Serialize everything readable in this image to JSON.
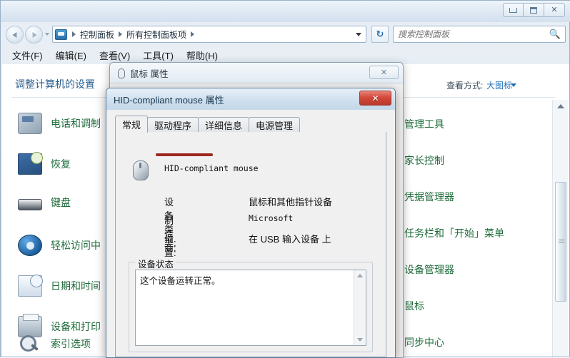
{
  "window": {
    "controls": {
      "minimize": "minimize-icon",
      "maximize": "maximize-icon",
      "close": "✕"
    }
  },
  "address": {
    "breadcrumbs": [
      "控制面板",
      "所有控制面板项"
    ],
    "refresh_label": "↻",
    "cp_icon": "control-panel-icon"
  },
  "search": {
    "placeholder": "搜索控制面板",
    "value": "",
    "icon": "🔍"
  },
  "menu": {
    "items": [
      "文件(F)",
      "编辑(E)",
      "查看(V)",
      "工具(T)",
      "帮助(H)"
    ]
  },
  "content": {
    "page_title": "调整计算机的设置",
    "viewby_label": "查看方式:",
    "viewby_value": "大图标",
    "left_items": [
      {
        "label": "电话和调制",
        "icon": "modem-icon"
      },
      {
        "label": "恢复",
        "icon": "recovery-icon"
      },
      {
        "label": "键盘",
        "icon": "keyboard-icon"
      },
      {
        "label": "轻松访问中",
        "icon": "ease-of-access-icon"
      },
      {
        "label": "日期和时间",
        "icon": "date-time-icon"
      },
      {
        "label": "设备和打印",
        "icon": "printer-icon"
      },
      {
        "label": "索引选项",
        "icon": "search-options-icon"
      }
    ],
    "right_items": [
      {
        "label": "管理工具"
      },
      {
        "label": "家长控制"
      },
      {
        "label": "凭据管理器"
      },
      {
        "label": "任务栏和「开始」菜单"
      },
      {
        "label": "设备管理器"
      },
      {
        "label": "鼠标"
      },
      {
        "label": "同步中心"
      }
    ]
  },
  "mouse_props_dialog": {
    "title": "鼠标 属性",
    "close_label": "✕",
    "icon": "mouse-icon"
  },
  "hid_dialog": {
    "title": "HID-compliant mouse 属性",
    "close_label": "✕",
    "tabs": [
      {
        "label": "常规",
        "active": true
      },
      {
        "label": "驱动程序",
        "active": false
      },
      {
        "label": "详细信息",
        "active": false
      },
      {
        "label": "电源管理",
        "active": false
      }
    ],
    "device_name": "HID-compliant mouse",
    "fields": [
      {
        "label": "设备类型:",
        "value": "鼠标和其他指针设备",
        "mono": false
      },
      {
        "label": "制造商:",
        "value": "Microsoft",
        "mono": true
      },
      {
        "label": "位置:",
        "value": "在 USB 输入设备 上",
        "mono": false
      }
    ],
    "status_group_label": "设备状态",
    "status_text": "这个设备运转正常。"
  },
  "colors": {
    "link_green": "#1e6b3a",
    "title_blue": "#2b5f8e",
    "close_red": "#d4493a",
    "annotation_red": "#9e2720"
  }
}
